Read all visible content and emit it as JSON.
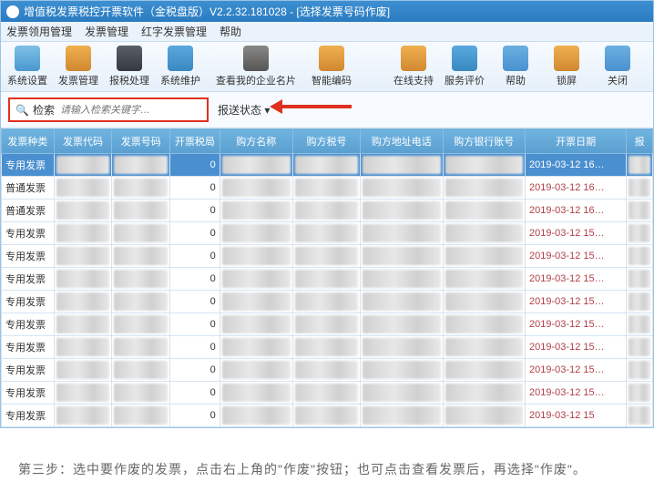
{
  "title": "增值税发票税控开票软件（金税盘版）V2.2.32.181028 - [选择发票号码作废]",
  "menu": [
    "发票领用管理",
    "发票管理",
    "红字发票管理",
    "帮助"
  ],
  "toolbar": [
    {
      "label": "系统设置",
      "icon": "gear"
    },
    {
      "label": "发票管理",
      "icon": "file"
    },
    {
      "label": "报税处理",
      "icon": "tablet"
    },
    {
      "label": "系统维护",
      "icon": "folder"
    },
    {
      "label": "查看我的企业名片",
      "icon": "mag",
      "wide": true
    },
    {
      "label": "智能编码",
      "icon": "grid"
    }
  ],
  "toolbar_right": [
    {
      "label": "在线支持",
      "icon": "person"
    },
    {
      "label": "服务评价",
      "icon": "star"
    },
    {
      "label": "帮助",
      "icon": "help"
    },
    {
      "label": "锁屏",
      "icon": "lock"
    },
    {
      "label": "关闭",
      "icon": "close"
    }
  ],
  "search": {
    "label": "检索",
    "placeholder": "请输入检索关键字…"
  },
  "status_label": "报送状态",
  "columns": [
    "发票种类",
    "发票代码",
    "发票号码",
    "开票税局",
    "购方名称",
    "购方税号",
    "购方地址电话",
    "购方银行账号",
    "开票日期",
    "报"
  ],
  "rows": [
    {
      "type": "专用发票",
      "tax": "0",
      "date": "2019-03-12 16…",
      "sel": true
    },
    {
      "type": "普通发票",
      "tax": "0",
      "date": "2019-03-12 16…"
    },
    {
      "type": "普通发票",
      "tax": "0",
      "date": "2019-03-12 16…"
    },
    {
      "type": "专用发票",
      "tax": "0",
      "date": "2019-03-12 15…"
    },
    {
      "type": "专用发票",
      "tax": "0",
      "date": "2019-03-12 15…"
    },
    {
      "type": "专用发票",
      "tax": "0",
      "date": "2019-03-12 15…"
    },
    {
      "type": "专用发票",
      "tax": "0",
      "date": "2019-03-12 15…"
    },
    {
      "type": "专用发票",
      "tax": "0",
      "date": "2019-03-12 15…"
    },
    {
      "type": "专用发票",
      "tax": "0",
      "date": "2019-03-12 15…"
    },
    {
      "type": "专用发票",
      "tax": "0",
      "date": "2019-03-12 15…"
    },
    {
      "type": "专用发票",
      "tax": "0",
      "date": "2019-03-12 15…"
    },
    {
      "type": "专用发票",
      "tax": "0",
      "date": "2019-03-12 15"
    }
  ],
  "instruction": "第三步：选中要作废的发票，点击右上角的\"作废\"按钮；也可点击查看发票后，再选择\"作废\"。"
}
